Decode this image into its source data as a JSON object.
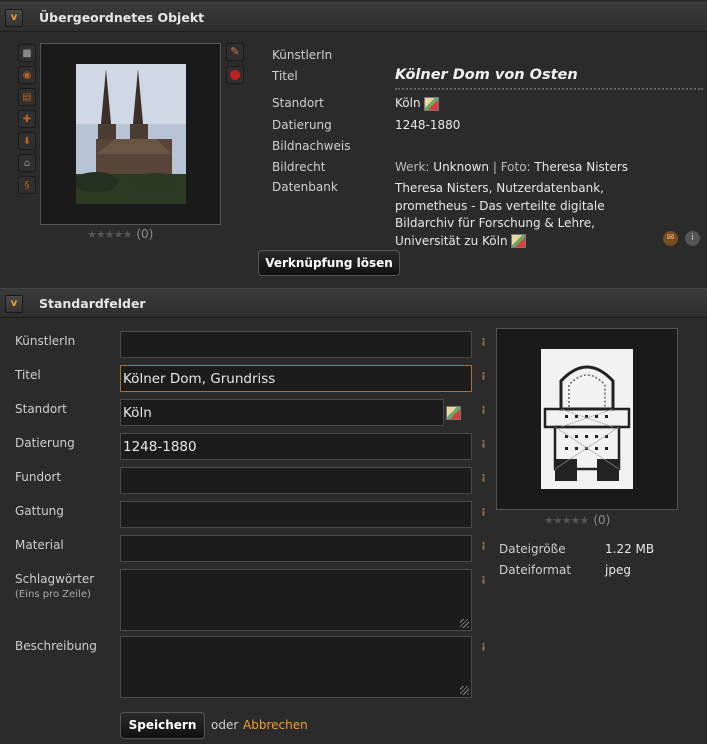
{
  "parent_section": {
    "title": "Übergeordnetes Objekt",
    "toggle": "v",
    "rating_count": "(0)",
    "fields": [
      {
        "label": "KünstlerIn",
        "value": ""
      },
      {
        "label": "Titel",
        "value": "Kölner Dom von Osten"
      },
      {
        "label": "Standort",
        "value": "Köln"
      },
      {
        "label": "Datierung",
        "value": "1248-1880"
      },
      {
        "label": "Bildnachweis",
        "value": ""
      },
      {
        "label": "Bildrecht",
        "value_prefix": "Werk: ",
        "value": "Unknown",
        "value_mid": " | Foto: ",
        "value2": "Theresa Nisters"
      },
      {
        "label": "Datenbank",
        "value_lines": [
          "Theresa Nisters, Nutzerdatenbank,",
          "prometheus - Das verteilte digitale",
          "Bildarchiv für Forschung & Lehre,",
          "Universität zu Köln"
        ]
      }
    ],
    "unlink_button": "Verknüpfung lösen"
  },
  "standard_section": {
    "title": "Standardfelder",
    "toggle": "v",
    "fields": [
      {
        "label": "KünstlerIn",
        "value": ""
      },
      {
        "label": "Titel",
        "value": "Kölner Dom, Grundriss"
      },
      {
        "label": "Standort",
        "value": "Köln"
      },
      {
        "label": "Datierung",
        "value": "1248-1880"
      },
      {
        "label": "Fundort",
        "value": ""
      },
      {
        "label": "Gattung",
        "value": ""
      },
      {
        "label": "Material",
        "value": ""
      },
      {
        "label": "Schlagwörter",
        "sublabel": "(Eins pro Zeile)",
        "value": ""
      },
      {
        "label": "Beschreibung",
        "value": ""
      }
    ],
    "rating_count": "(0)",
    "file_info": [
      {
        "label": "Dateigröße",
        "value": "1.22 MB"
      },
      {
        "label": "Dateiformat",
        "value": "jpeg"
      }
    ],
    "save_button": "Speichern",
    "or_text": "oder",
    "cancel_link": "Abbrechen"
  },
  "colors": {
    "accent": "#f0a030",
    "link": "#f0a030",
    "background": "#2b2b2b"
  }
}
